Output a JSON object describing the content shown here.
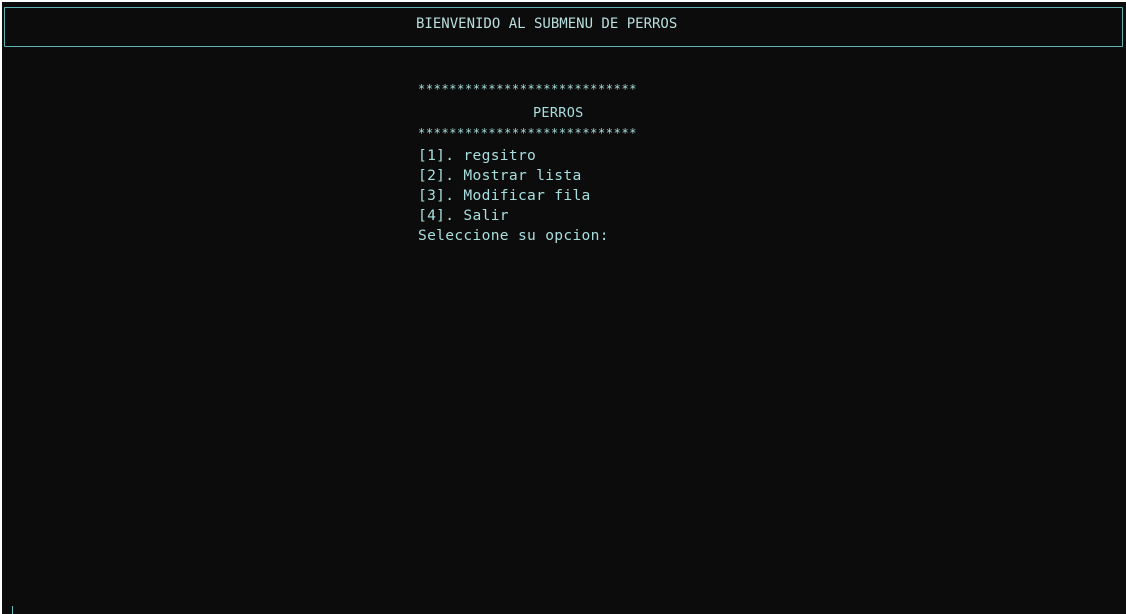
{
  "header": {
    "title": "BIENVENIDO AL SUBMENU DE PERROS"
  },
  "menu": {
    "top_border": "****************************",
    "title": "PERROS",
    "bottom_border": "****************************",
    "options": [
      {
        "label": "[1]. regsitro"
      },
      {
        "label": "[2]. Mostrar lista"
      },
      {
        "label": "[3]. Modificar fila"
      },
      {
        "label": "[4]. Salir"
      }
    ],
    "prompt": "Seleccione su opcion:"
  },
  "colors": {
    "background": "#0c0c0c",
    "text": "#a9dede",
    "border": "#5fb2b2"
  }
}
